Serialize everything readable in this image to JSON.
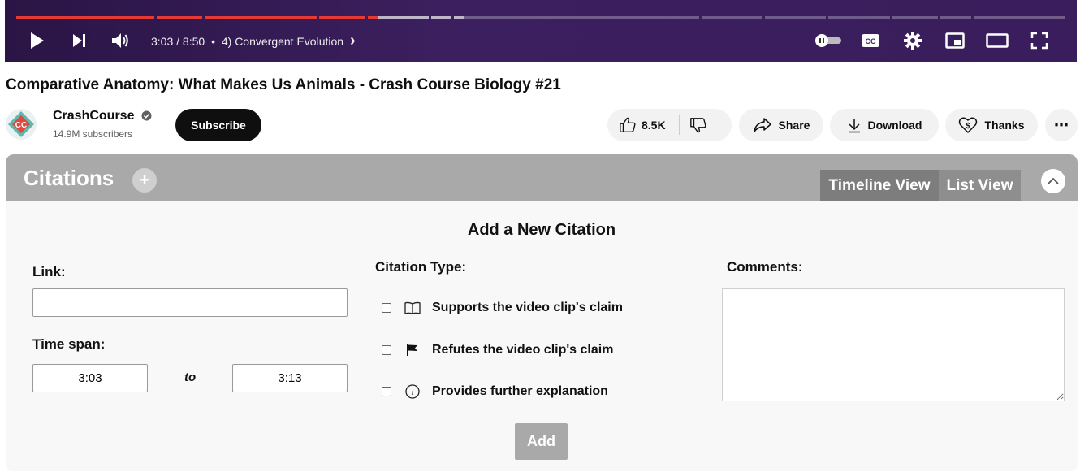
{
  "player": {
    "time_current": "3:03",
    "time_total": "8:50",
    "time_separator": " / ",
    "chapter_bullet": "•",
    "chapter_title": "4) Convergent Evolution",
    "chapter_arrow": "›",
    "played_fraction": 0.345,
    "buffered_fraction": 0.425,
    "chapter_fractions": [
      0.135,
      0.045,
      0.11,
      0.045,
      0.06,
      0.02,
      0.24,
      0.06,
      0.06,
      0.06,
      0.045,
      0.03,
      0.09
    ],
    "colors": {
      "played": "#e53935",
      "bar_bg": "#3b1f5e"
    },
    "icons": [
      "play-icon",
      "next-icon",
      "volume-icon",
      "autoplay-toggle-icon",
      "captions-icon",
      "settings-icon",
      "miniplayer-icon",
      "theater-icon",
      "fullscreen-icon"
    ]
  },
  "video": {
    "title": "Comparative Anatomy: What Makes Us Animals - Crash Course Biology #21"
  },
  "channel": {
    "name": "CrashCourse",
    "subscribers": "14.9M subscribers",
    "subscribe_label": "Subscribe",
    "avatar_text": "CC"
  },
  "actions": {
    "likes": "8.5K",
    "share": "Share",
    "download": "Download",
    "thanks": "Thanks",
    "more": "⋯"
  },
  "citations": {
    "title": "Citations",
    "add_symbol": "+",
    "tabs": {
      "timeline": "Timeline View",
      "list": "List View"
    },
    "form_title": "Add a New Citation",
    "link_label": "Link:",
    "link_value": "",
    "timespan_label": "Time span:",
    "time_start": "3:03",
    "to_label": "to",
    "time_end": "3:13",
    "type_label": "Citation Type:",
    "types": [
      {
        "label": "Supports the video clip's claim",
        "icon": "book-icon",
        "checked": false
      },
      {
        "label": "Refutes the video clip's claim",
        "icon": "flag-icon",
        "checked": false
      },
      {
        "label": "Provides further explanation",
        "icon": "info-icon",
        "checked": false
      }
    ],
    "comments_label": "Comments:",
    "comments_value": "",
    "add_button": "Add",
    "colors": {
      "header": "#a9a9a9",
      "body": "#f8f8f8",
      "button": "#a9a9a9"
    }
  }
}
